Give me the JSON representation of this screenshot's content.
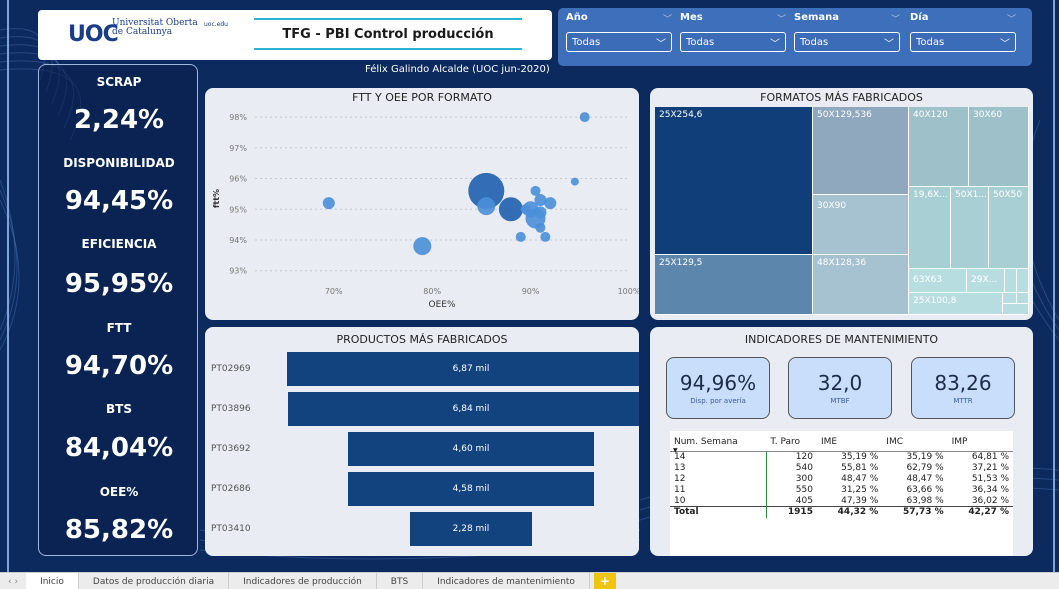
{
  "header": {
    "logo_uoc": "UOC",
    "logo_subtitle": "Universitat Oberta de Catalunya",
    "logo_domain": "uoc.edu",
    "title": "TFG - PBI Control producción",
    "author": "Félix Galindo Alcalde (UOC jun-2020)"
  },
  "filters": [
    {
      "label": "Año",
      "value": "Todas"
    },
    {
      "label": "Mes",
      "value": "Todas"
    },
    {
      "label": "Semana",
      "value": "Todas"
    },
    {
      "label": "Día",
      "value": "Todas"
    }
  ],
  "kpis": [
    {
      "label": "SCRAP",
      "value": "2,24%"
    },
    {
      "label": "DISPONIBILIDAD",
      "value": "94,45%"
    },
    {
      "label": "EFICIENCIA",
      "value": "95,95%"
    },
    {
      "label": "FTT",
      "value": "94,70%"
    },
    {
      "label": "BTS",
      "value": "84,04%"
    },
    {
      "label": "OEE%",
      "value": "85,82%"
    }
  ],
  "scatter": {
    "title": "FTT Y OEE POR FORMATO",
    "xlabel": "OEE%",
    "ylabel": "ftt%",
    "xticks": [
      "70%",
      "80%",
      "90%",
      "100%"
    ],
    "yticks": [
      "98%",
      "97%",
      "96%",
      "95%",
      "94%",
      "93%"
    ]
  },
  "treemap": {
    "title": "FORMATOS MÁS FABRICADOS",
    "labels": [
      "25X254,6",
      "50X129,536",
      "40X120",
      "30X60",
      "30X90",
      "19,6X...",
      "50X1...",
      "50X50",
      "25X129,5",
      "48X128,36",
      "63X63",
      "29X...",
      "25X100,8"
    ]
  },
  "products": {
    "title": "PRODUCTOS MÁS FABRICADOS"
  },
  "maintenance": {
    "title": "INDICADORES DE MANTENIMIENTO",
    "cards": [
      {
        "value": "94,96%",
        "label": "Disp. por avería"
      },
      {
        "value": "32,0",
        "label": "MTBF"
      },
      {
        "value": "83,26",
        "label": "MTTR"
      }
    ],
    "table": {
      "headers": [
        "Num. Semana",
        "T. Paro",
        "IME",
        "IMC",
        "IMP"
      ],
      "rows": [
        [
          "14",
          "120",
          "35,19 %",
          "35,19 %",
          "64,81 %"
        ],
        [
          "13",
          "540",
          "55,81 %",
          "62,79 %",
          "37,21 %"
        ],
        [
          "12",
          "300",
          "48,47 %",
          "48,47 %",
          "51,53 %"
        ],
        [
          "11",
          "550",
          "31,25 %",
          "63,66 %",
          "36,34 %"
        ],
        [
          "10",
          "405",
          "47,39 %",
          "63,98 %",
          "36,02 %"
        ]
      ],
      "total": [
        "Total",
        "1915",
        "44,32 %",
        "57,73 %",
        "42,27 %"
      ]
    }
  },
  "tabs": {
    "items": [
      "Inicio",
      "Datos de producción diaria",
      "Indicadores de producción",
      "BTS",
      "Indicadores de mantenimiento"
    ],
    "add": "+"
  },
  "chart_data": [
    {
      "type": "scatter",
      "title": "FTT Y OEE POR FORMATO",
      "xlabel": "OEE%",
      "ylabel": "ftt%",
      "xlim": [
        62,
        100
      ],
      "ylim": [
        92.6,
        98.1
      ],
      "x": [
        95.5,
        69.5,
        85.5,
        85.5,
        88.0,
        79.0,
        90.5,
        90.0,
        91.0,
        89.5,
        92.0,
        94.5,
        90.5,
        91.0,
        89.0,
        91.5,
        91.0
      ],
      "y": [
        98.0,
        95.2,
        95.6,
        95.1,
        95.0,
        93.8,
        94.7,
        95.0,
        95.3,
        95.0,
        95.2,
        95.9,
        95.6,
        94.4,
        94.1,
        94.1,
        94.9
      ],
      "size": [
        5,
        6,
        18,
        9,
        12,
        9,
        10,
        8,
        6,
        5,
        6,
        4,
        5,
        5,
        5,
        5,
        6
      ]
    },
    {
      "type": "bar",
      "title": "PRODUCTOS MÁS FABRICADOS",
      "categories": [
        "PT02969",
        "PT03896",
        "PT03692",
        "PT02686",
        "PT03410"
      ],
      "values": [
        6.87,
        6.84,
        4.6,
        4.58,
        2.28
      ],
      "labels": [
        "6,87 mil",
        "6,84 mil",
        "4,60 mil",
        "4,58 mil",
        "2,28 mil"
      ]
    }
  ],
  "colors": {
    "background": "#0c2a5e",
    "bar": "#13437f",
    "bubble": "#4a8fd9",
    "bubble_dark": "#1f5fae",
    "filter_panel": "#3d6fbb",
    "card": "#c9defa"
  }
}
